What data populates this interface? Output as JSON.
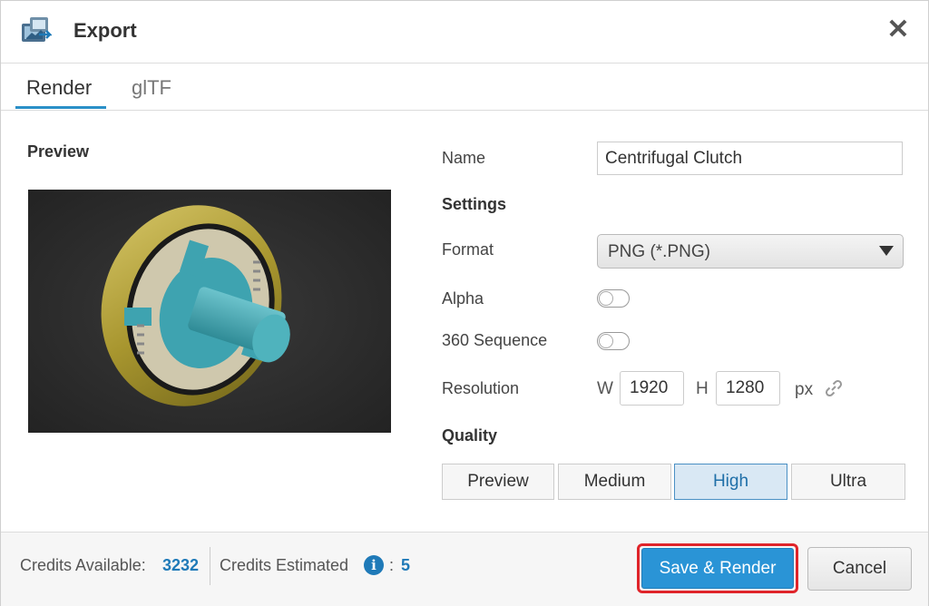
{
  "header": {
    "title": "Export",
    "app_icon": "export-app-icon",
    "close_icon": "close-icon",
    "close_glyph": "✕"
  },
  "tabs": [
    {
      "label": "Render",
      "active": true
    },
    {
      "label": "glTF",
      "active": false
    }
  ],
  "preview": {
    "label": "Preview"
  },
  "form": {
    "name_label": "Name",
    "name_value": "Centrifugal Clutch",
    "settings_label": "Settings",
    "format_label": "Format",
    "format_value": "PNG (*.PNG)",
    "alpha_label": "Alpha",
    "alpha_on": false,
    "sequence_label": "360 Sequence",
    "sequence_on": false,
    "resolution_label": "Resolution",
    "width_letter": "W",
    "width_value": "1920",
    "height_letter": "H",
    "height_value": "1280",
    "unit": "px",
    "link_icon": "link-icon"
  },
  "quality": {
    "label": "Quality",
    "options": [
      "Preview",
      "Medium",
      "High",
      "Ultra"
    ],
    "selected": "High"
  },
  "footer": {
    "credits_available_label": "Credits Available:",
    "credits_available_value": "3232",
    "credits_estimated_label": "Credits Estimated",
    "credits_separator": ":",
    "credits_estimated_value": "5",
    "save_label": "Save & Render",
    "cancel_label": "Cancel"
  },
  "colors": {
    "accent": "#2a94d6",
    "highlight_outline": "#e0242a",
    "selected_quality": "#d9e8f4"
  }
}
